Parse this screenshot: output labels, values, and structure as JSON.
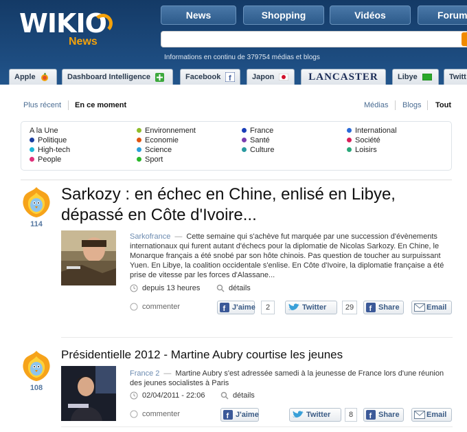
{
  "brand": {
    "logo_main": "WIKIO",
    "logo_sub": "News"
  },
  "topnav": [
    "News",
    "Shopping",
    "Vidéos",
    "Forum"
  ],
  "tagline": "Informations en continu de 379754 médias et blogs",
  "tabs": [
    "Apple",
    "Dashboard Intelligence",
    "Facebook",
    "Japon",
    "LANCASTER",
    "Libye",
    "Twitt"
  ],
  "sort": {
    "left": [
      "Plus récent",
      "En ce moment"
    ],
    "right": [
      "Médias",
      "Blogs",
      "Tout"
    ]
  },
  "categories": [
    {
      "label": "A la Une",
      "color": ""
    },
    {
      "label": "Politique",
      "color": "#1a3fa0"
    },
    {
      "label": "High-tech",
      "color": "#1cb7d8"
    },
    {
      "label": "People",
      "color": "#e0307a"
    },
    {
      "label": "Environnement",
      "color": "#8fbd2a"
    },
    {
      "label": "Economie",
      "color": "#e05512"
    },
    {
      "label": "Science",
      "color": "#2ba0d8"
    },
    {
      "label": "Sport",
      "color": "#2ab82a"
    },
    {
      "label": "France",
      "color": "#1a3fb8"
    },
    {
      "label": "Santé",
      "color": "#7a3fb0"
    },
    {
      "label": "Culture",
      "color": "#2a9aa0"
    },
    {
      "label": "International",
      "color": "#2a6ad8"
    },
    {
      "label": "Société",
      "color": "#d8205a"
    },
    {
      "label": "Loisirs",
      "color": "#2aa87a"
    }
  ],
  "articles": [
    {
      "score": "114",
      "title": "Sarkozy : en échec en Chine, enlisé en Libye, dépassé en Côte d'Ivoire...",
      "source": "Sarkofrance",
      "summary": "Cette semaine qui s'achève fut marquée par une succession d'évènements internationaux qui furent autant d'échecs pour la diplomatie de Nicolas Sarkozy. En Chine, le Monarque français a été snobé par son hôte chinois. Pas question de toucher au surpuissant Yuen. En Libye, la coalition occidentale s'enlise. En Côte d'Ivoire, la diplomatie française a été prise de vitesse par les forces d'Alassane...",
      "time": "depuis 13 heures",
      "details": "détails",
      "comment": "commenter",
      "like": "J'aime",
      "like_count": "2",
      "twitter": "Twitter",
      "twitter_count": "29",
      "share": "Share",
      "email": "Email"
    },
    {
      "score": "108",
      "title": "Présidentielle 2012 - Martine Aubry courtise les jeunes",
      "source": "France 2",
      "summary": "Martine Aubry s'est adressée samedi à la jeunesse de France lors d'une réunion des jeunes socialistes à Paris",
      "time": "02/04/2011 - 22:06",
      "details": "détails",
      "comment": "commenter",
      "like": "J'aime",
      "twitter": "Twitter",
      "twitter_count": "8",
      "share": "Share",
      "email": "Email"
    }
  ]
}
